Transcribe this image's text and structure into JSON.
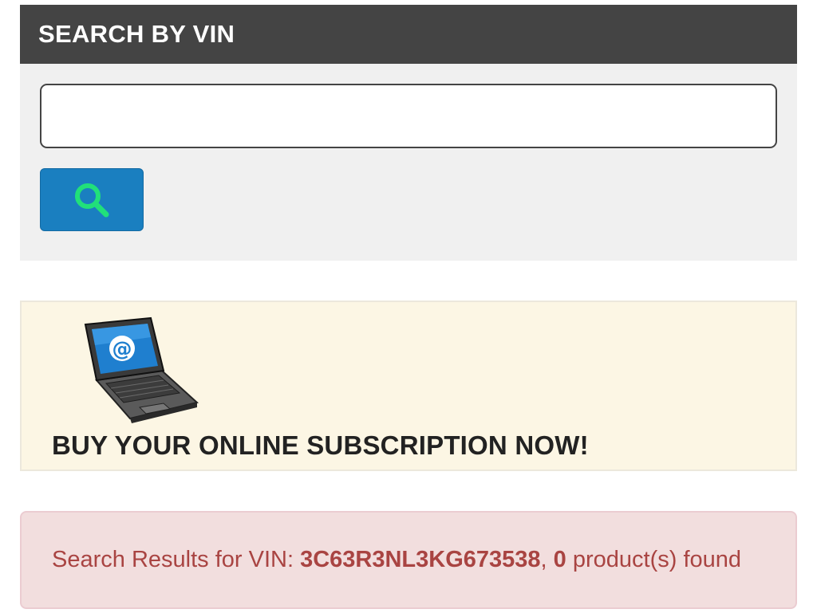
{
  "search": {
    "header": "SEARCH BY VIN",
    "input_value": "",
    "input_placeholder": "",
    "button_icon": "search-icon",
    "button_color": "#1a7fc0",
    "icon_color": "#21e07a"
  },
  "promo": {
    "image_icon": "laptop-email-icon",
    "text": "BUY YOUR ONLINE SUBSCRIPTION NOW!"
  },
  "results": {
    "prefix": "Search Results for VIN: ",
    "vin": "3C63R3NL3KG673538",
    "separator": ", ",
    "count": "0",
    "suffix": " product(s) found"
  },
  "colors": {
    "header_bg": "#444444",
    "panel_bg": "#f0f0f0",
    "promo_bg": "#fcf6e4",
    "alert_bg": "#f2dede",
    "alert_text": "#a94442"
  }
}
